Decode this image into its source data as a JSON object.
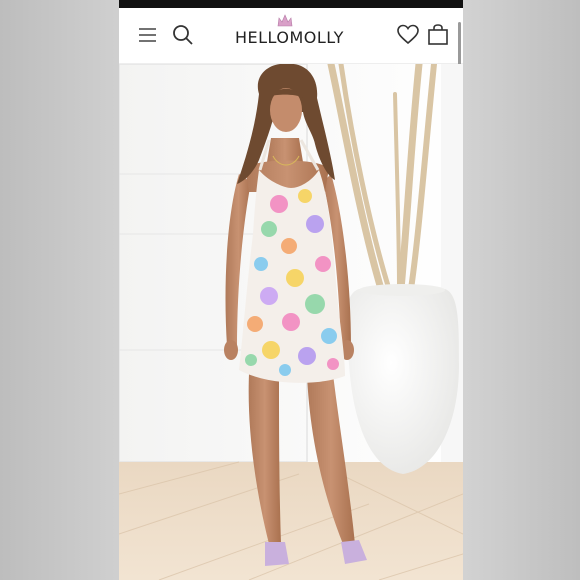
{
  "app": {
    "brand": "HELLOMOLLY"
  },
  "header": {
    "menu_icon": "hamburger-icon",
    "search_icon": "search-icon",
    "wishlist_icon": "heart-icon",
    "bag_icon": "shopping-bag-icon"
  },
  "hero": {
    "content": "product-photo",
    "subject": "model-in-floral-sequin-halter-mini-dress"
  },
  "colors": {
    "brand_pink": "#d9a0c8",
    "text": "#222222"
  }
}
